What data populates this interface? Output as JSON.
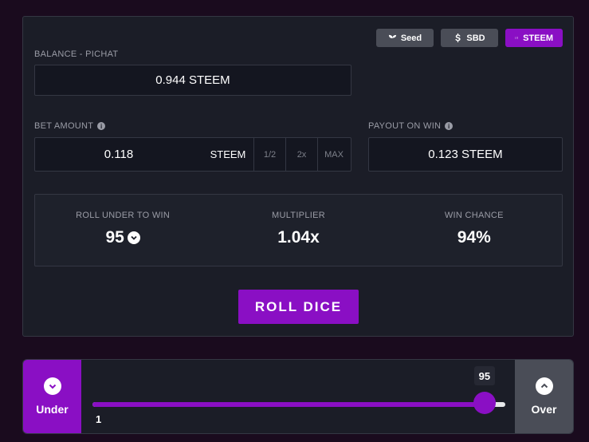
{
  "currencies": [
    {
      "label": "Seed",
      "icon": "seedling-icon"
    },
    {
      "label": "SBD",
      "icon": "dollar-icon"
    },
    {
      "label": "STEEM",
      "icon": "steem-icon",
      "active": true
    }
  ],
  "balance": {
    "label": "BALANCE - PICHAT",
    "value": "0.944 STEEM"
  },
  "bet": {
    "label": "BET AMOUNT",
    "value": "0.118",
    "unit": "STEEM",
    "half": "1/2",
    "double": "2x",
    "max": "MAX"
  },
  "payout": {
    "label": "PAYOUT ON WIN",
    "value": "0.123 STEEM"
  },
  "stats": {
    "roll_under_label": "ROLL UNDER TO WIN",
    "roll_under_value": "95",
    "multiplier_label": "MULTIPLIER",
    "multiplier_value": "1.04x",
    "win_chance_label": "WIN CHANCE",
    "win_chance_value": "94%"
  },
  "roll_button": "ROLL DICE",
  "slider": {
    "under_label": "Under",
    "over_label": "Over",
    "value": 95,
    "value_label": "95",
    "min": 1,
    "max": 100,
    "min_label": "1"
  },
  "colors": {
    "accent": "#8a0fc4",
    "background": "#1a0b1e",
    "panel": "#1b1d27",
    "button_gray": "#4a4d57"
  }
}
